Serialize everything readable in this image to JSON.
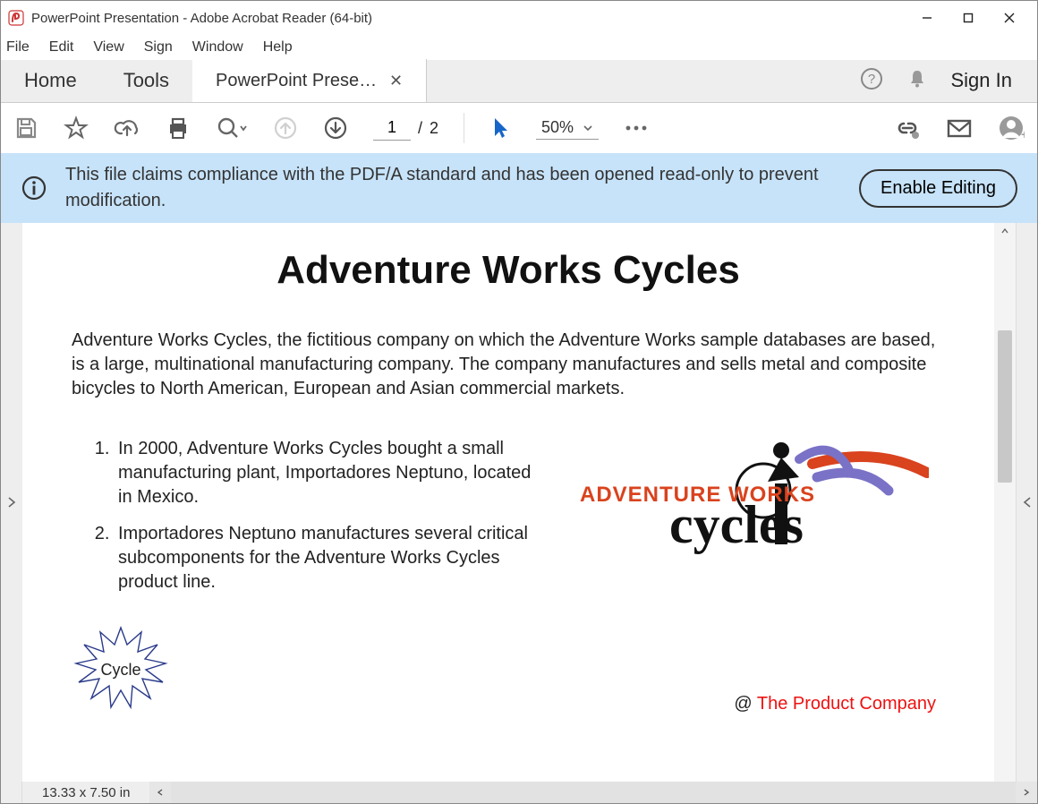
{
  "titlebar": {
    "title": "PowerPoint Presentation - Adobe Acrobat Reader (64-bit)"
  },
  "menubar": {
    "items": [
      "File",
      "Edit",
      "View",
      "Sign",
      "Window",
      "Help"
    ]
  },
  "tabs": {
    "home": "Home",
    "tools": "Tools",
    "doc": "PowerPoint Present..."
  },
  "rightbar": {
    "signin": "Sign In"
  },
  "toolbar": {
    "page_current": "1",
    "page_total": "2",
    "zoom": "50%"
  },
  "info": {
    "message": "This file claims compliance with the PDF/A standard and has been opened read-only to prevent modification.",
    "enable": "Enable Editing"
  },
  "document": {
    "title": "Adventure Works Cycles",
    "para": "Adventure Works Cycles, the fictitious company on which the Adventure Works sample databases are based, is a large, multinational manufacturing company. The company manufactures and sells metal and composite bicycles to North American, European and Asian commercial markets.",
    "list": [
      "In 2000, Adventure Works Cycles bought a small manufacturing plant, Importadores Neptuno, located in Mexico.",
      "Importadores Neptuno manufactures several critical subcomponents for the Adventure Works Cycles product line."
    ],
    "logo_line1": "ADVENTURE WORKS",
    "logo_line2": "cycles",
    "burst": "Cycle",
    "footer_at": "@ ",
    "footer_name": "The Product Company"
  },
  "statusbar": {
    "dimensions": "13.33 x 7.50 in"
  }
}
